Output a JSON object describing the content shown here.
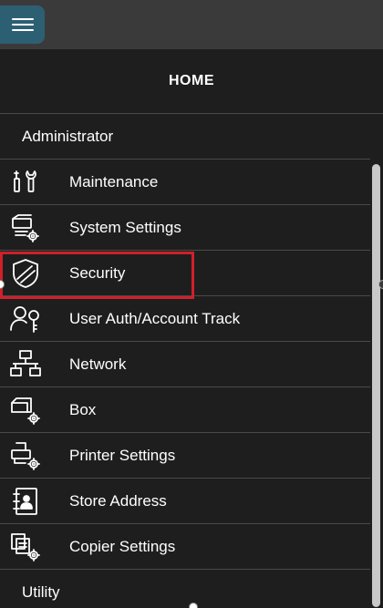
{
  "header": {
    "menu_icon": "hamburger-menu-icon",
    "title": "HOME"
  },
  "section": {
    "title": "Administrator"
  },
  "items": [
    {
      "label": "Maintenance",
      "icon": "maintenance-tools-icon"
    },
    {
      "label": "System Settings",
      "icon": "system-settings-icon"
    },
    {
      "label": "Security",
      "icon": "shield-icon",
      "selected": true
    },
    {
      "label": "User Auth/Account Track",
      "icon": "user-key-icon"
    },
    {
      "label": "Network",
      "icon": "network-icon"
    },
    {
      "label": "Box",
      "icon": "box-settings-icon"
    },
    {
      "label": "Printer Settings",
      "icon": "printer-settings-icon"
    },
    {
      "label": "Store Address",
      "icon": "address-book-icon"
    },
    {
      "label": "Copier Settings",
      "icon": "copier-settings-icon"
    }
  ],
  "footer_section": {
    "title": "Utility"
  },
  "colors": {
    "panel_background": "#1e1e1e",
    "menu_button": "#2d5f73",
    "highlight_border": "#d0202a"
  }
}
